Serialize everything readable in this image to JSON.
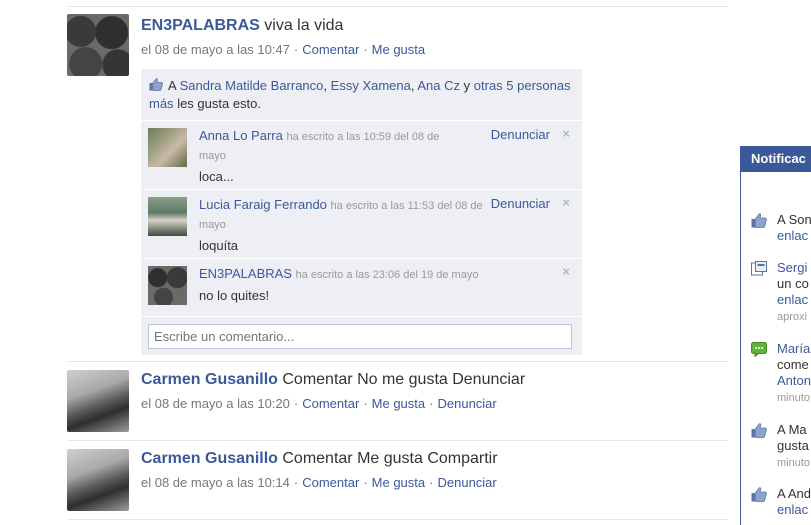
{
  "post1": {
    "author": "EN3PALABRAS",
    "text": "viva la vida",
    "date": "el 08 de mayo a las 10:47",
    "action_comment": "Comentar",
    "action_like": "Me gusta",
    "likes": {
      "prefix": "A",
      "name1": "Sandra Matilde Barranco",
      "comma1": ",",
      "name2": "Essy Xamena",
      "comma2": ",",
      "name3": "Ana Cz",
      "and": "y",
      "others": "otras 5 personas más",
      "suffix": "les gusta esto."
    },
    "comments": [
      {
        "name": "Anna Lo Parra",
        "time": "ha escrito a las 10:59 del 08 de mayo",
        "text": "loca...",
        "report": "Denunciar",
        "close": "×"
      },
      {
        "name": "Lucia Faraig Ferrando",
        "time": "ha escrito a las 11:53 del 08 de mayo",
        "text": "loquíta",
        "report": "Denunciar",
        "close": "×"
      },
      {
        "name": "EN3PALABRAS",
        "time": "ha escrito a las 23:06 del 19 de mayo",
        "text": "no lo quites!",
        "close": "×"
      }
    ],
    "comment_placeholder": "Escribe un comentario..."
  },
  "post2": {
    "author": "Carmen Gusanillo",
    "text": "Comentar No me gusta Denunciar",
    "date": "el 08 de mayo a las 10:20",
    "action_comment": "Comentar",
    "action_like": "Me gusta",
    "action_report": "Denunciar"
  },
  "post3": {
    "author": "Carmen Gusanillo",
    "text": "Comentar Me gusta Compartir",
    "date": "el 08 de mayo a las 10:14",
    "action_comment": "Comentar",
    "action_like": "Me gusta",
    "action_report": "Denunciar"
  },
  "sidebar": {
    "title": "Notificac",
    "items": [
      {
        "icon": "like-icon",
        "lines": [
          "A Son",
          "enlac"
        ]
      },
      {
        "icon": "share-icon",
        "lines": [
          "Sergi",
          "un co",
          "enlac",
          "aproxi"
        ]
      },
      {
        "icon": "comment-icon",
        "lines": [
          "María",
          "come",
          "Anton",
          "minuto"
        ]
      },
      {
        "icon": "like-icon",
        "lines": [
          "A Ma",
          "gusta",
          "minuto"
        ]
      },
      {
        "icon": "like-icon",
        "lines": [
          "A And",
          "enlac"
        ]
      }
    ]
  },
  "colors": {
    "link": "#3b5998",
    "feedback_bg": "#edeff4",
    "meta": "#777777"
  }
}
